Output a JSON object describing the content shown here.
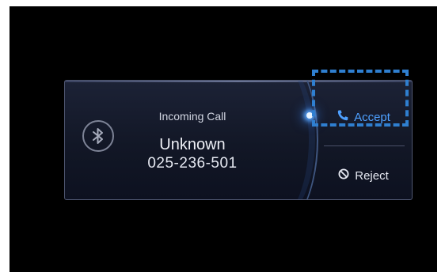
{
  "dialog": {
    "label": "Incoming Call",
    "caller_name": "Unknown",
    "caller_number": "025-236-501"
  },
  "actions": {
    "accept_label": "Accept",
    "reject_label": "Reject"
  },
  "icons": {
    "bluetooth": "bluetooth-icon",
    "accept": "phone-icon",
    "reject": "block-icon"
  },
  "colors": {
    "screen_background": "#000000",
    "accept_accent": "#4ea0ff",
    "highlight_box": "#2f7fd0"
  }
}
